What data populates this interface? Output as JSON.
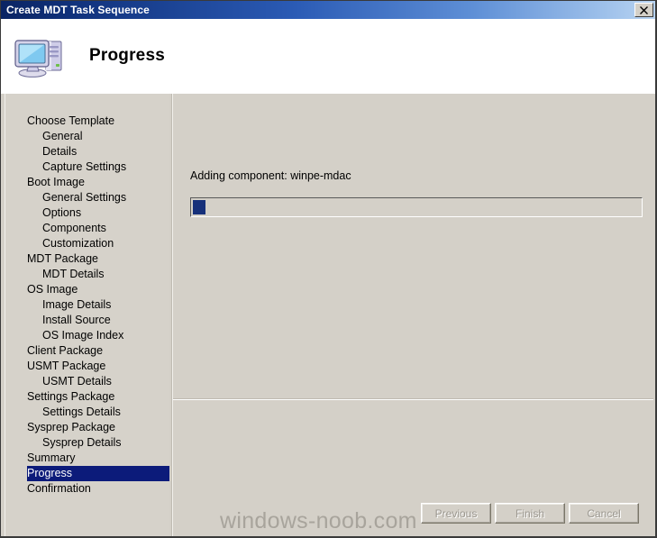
{
  "window": {
    "title": "Create MDT Task Sequence",
    "close_icon": "close-icon"
  },
  "header": {
    "title": "Progress",
    "icon": "computer-monitor-icon"
  },
  "sidebar": {
    "items": [
      {
        "label": "Choose Template",
        "level": 0,
        "selected": false
      },
      {
        "label": "General",
        "level": 1,
        "selected": false
      },
      {
        "label": "Details",
        "level": 1,
        "selected": false
      },
      {
        "label": "Capture Settings",
        "level": 1,
        "selected": false
      },
      {
        "label": "Boot Image",
        "level": 0,
        "selected": false
      },
      {
        "label": "General Settings",
        "level": 1,
        "selected": false
      },
      {
        "label": "Options",
        "level": 1,
        "selected": false
      },
      {
        "label": "Components",
        "level": 1,
        "selected": false
      },
      {
        "label": "Customization",
        "level": 1,
        "selected": false
      },
      {
        "label": "MDT Package",
        "level": 0,
        "selected": false
      },
      {
        "label": "MDT Details",
        "level": 1,
        "selected": false
      },
      {
        "label": "OS Image",
        "level": 0,
        "selected": false
      },
      {
        "label": "Image Details",
        "level": 1,
        "selected": false
      },
      {
        "label": "Install Source",
        "level": 1,
        "selected": false
      },
      {
        "label": "OS Image Index",
        "level": 1,
        "selected": false
      },
      {
        "label": "Client Package",
        "level": 0,
        "selected": false
      },
      {
        "label": "USMT Package",
        "level": 0,
        "selected": false
      },
      {
        "label": "USMT Details",
        "level": 1,
        "selected": false
      },
      {
        "label": "Settings Package",
        "level": 0,
        "selected": false
      },
      {
        "label": "Settings Details",
        "level": 1,
        "selected": false
      },
      {
        "label": "Sysprep Package",
        "level": 0,
        "selected": false
      },
      {
        "label": "Sysprep Details",
        "level": 1,
        "selected": false
      },
      {
        "label": "Summary",
        "level": 0,
        "selected": false
      },
      {
        "label": "Progress",
        "level": 0,
        "selected": true
      },
      {
        "label": "Confirmation",
        "level": 0,
        "selected": false
      }
    ],
    "selected_bg": "#0c1b7a",
    "selected_fg": "#ffffff"
  },
  "content": {
    "status_text": "Adding component: winpe-mdac",
    "progress": {
      "style": "marquee",
      "chunk_color": "#16307a",
      "percent": 3
    }
  },
  "footer": {
    "buttons": [
      {
        "label": "Previous",
        "name": "previous-button",
        "disabled": true
      },
      {
        "label": "Finish",
        "name": "finish-button",
        "disabled": true
      },
      {
        "label": "Cancel",
        "name": "cancel-button",
        "disabled": true
      }
    ]
  },
  "watermark": {
    "text": "windows-noob.com",
    "color": "#a8a49c"
  }
}
